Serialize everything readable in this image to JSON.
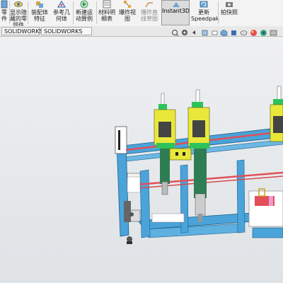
{
  "toolbar": {
    "items": [
      {
        "label": "零\n件",
        "icon": "part-icon"
      },
      {
        "label": "显示隐\n藏的零\n部件",
        "icon": "show-hidden-icon"
      },
      {
        "label": "装配体\n特征",
        "icon": "assembly-feature-icon"
      },
      {
        "label": "参考几\n何体",
        "icon": "reference-geometry-icon"
      },
      {
        "label": "新建运\n动算例",
        "icon": "new-motion-study-icon"
      },
      {
        "label": "材料明\n细表",
        "icon": "bill-of-materials-icon"
      },
      {
        "label": "爆炸视\n图",
        "icon": "exploded-view-icon"
      },
      {
        "label": "爆炸直\n线草图",
        "icon": "explode-line-sketch-icon"
      },
      {
        "label": "Instant3D",
        "icon": "instant3d-icon"
      },
      {
        "label": "更新\nSpeedpak",
        "icon": "update-speedpak-icon"
      },
      {
        "label": "拍快照",
        "icon": "snapshot-icon"
      }
    ]
  },
  "tabs": [
    "SOLIDWORKS 插件",
    "SOLIDWORKS MBD"
  ],
  "colors": {
    "frame": "#4aa3d9",
    "yellow": "#e9e83a",
    "green": "#2ec35a",
    "pink": "#e24f57"
  }
}
